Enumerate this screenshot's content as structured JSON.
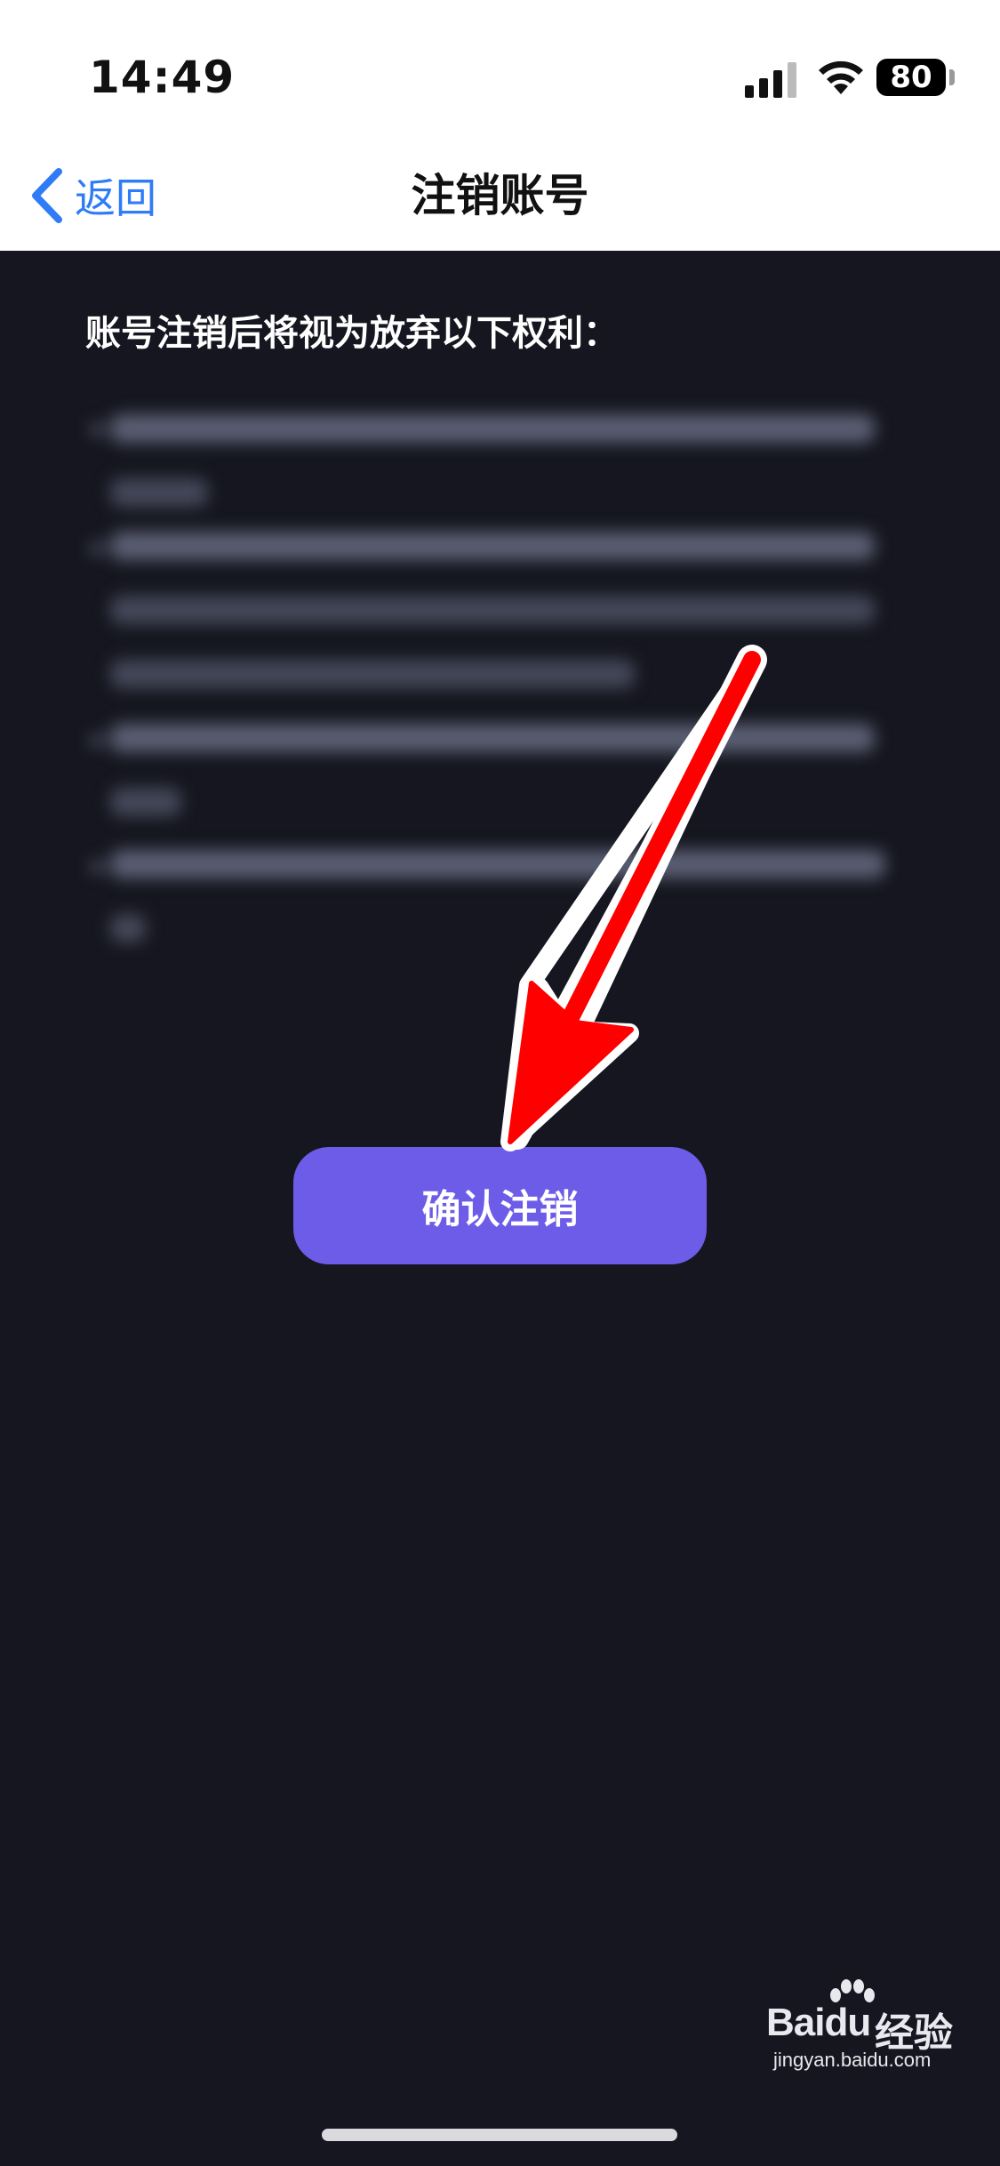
{
  "status_bar": {
    "time": "14:49",
    "battery": "80"
  },
  "nav": {
    "back_label": "返回",
    "title": "注销账号"
  },
  "content": {
    "intro": "账号注销后将视为放弃以下权利："
  },
  "actions": {
    "confirm_label": "确认注销"
  },
  "watermark": {
    "brand": "Bai",
    "brand_du": "du",
    "suffix": "经验",
    "url": "jingyan.baidu.com"
  },
  "colors": {
    "background": "#15161f",
    "accent": "#6d5ce7",
    "link": "#2f7cf6",
    "annotation_arrow": "#ff0000"
  }
}
